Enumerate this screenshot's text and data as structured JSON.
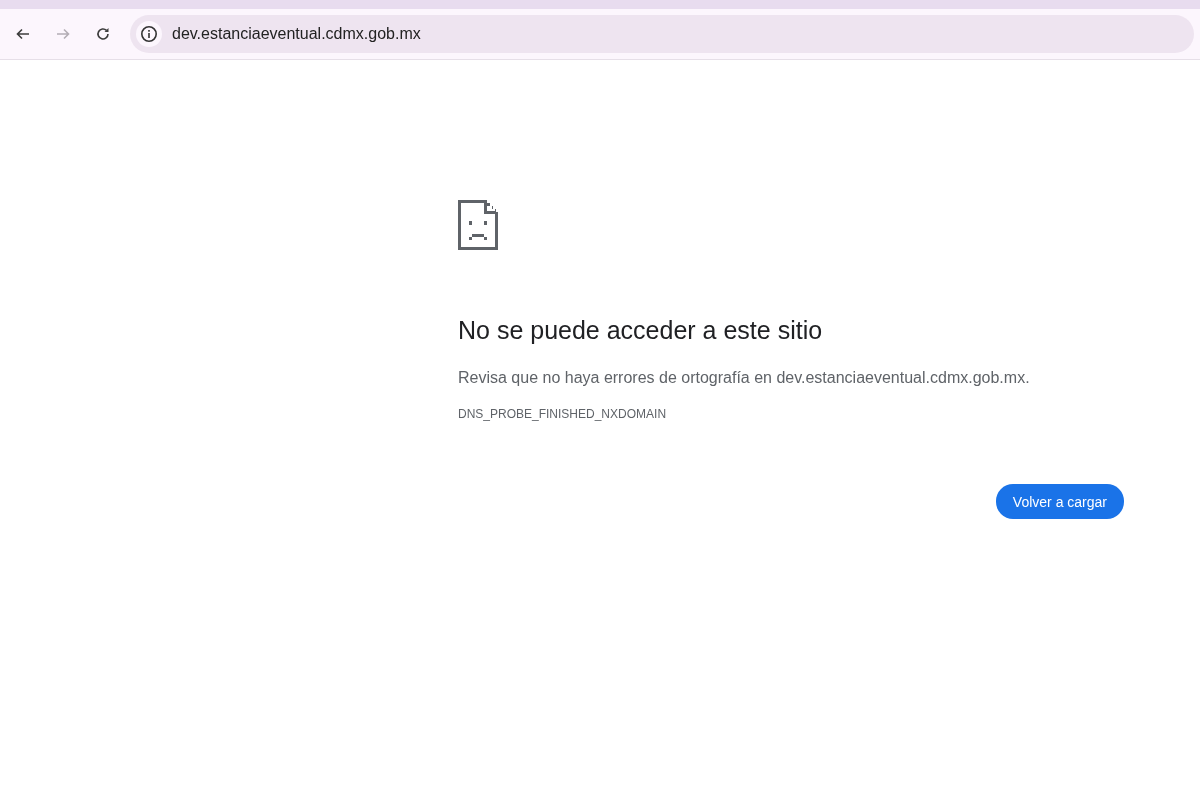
{
  "toolbar": {
    "nav_buttons": [
      {
        "kind": "back",
        "disabled": false
      },
      {
        "kind": "forward",
        "disabled": true
      },
      {
        "kind": "reload",
        "disabled": false
      }
    ],
    "address": "dev.estanciaeventual.cdmx.gob.mx"
  },
  "error": {
    "title": "No se puede acceder a este sitio",
    "message": "Revisa que no haya errores de ortografía en dev.estanciaeventual.cdmx.gob.mx.",
    "code": "DNS_PROBE_FINISHED_NXDOMAIN",
    "button": "Volver a cargar"
  }
}
